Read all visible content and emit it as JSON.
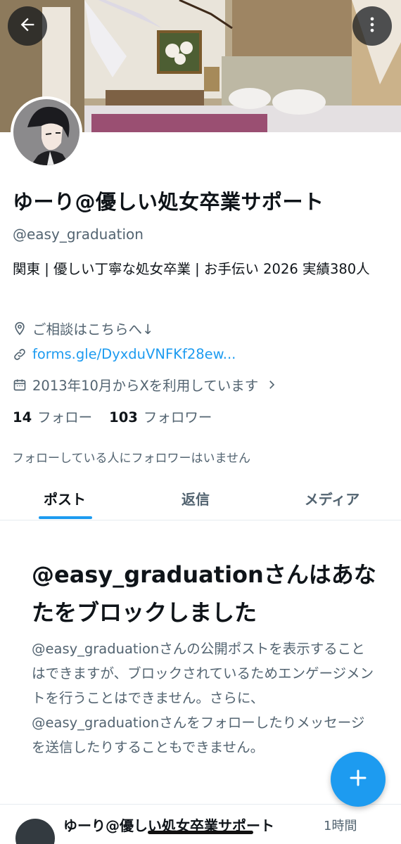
{
  "header": {
    "back_icon": "arrow-left-icon",
    "more_icon": "more-vertical-icon"
  },
  "profile": {
    "display_name": "ゆーり@優しい処女卒業サポート",
    "handle": "@easy_graduation",
    "bio": "関東 | 優しい丁寧な処女卒業 | お手伝い 2026 実績380人",
    "location": "ご相談はこちらへ↓",
    "link": "forms.gle/DyxduVNFKf28ew...",
    "joined": "2013年10月からXを利用しています",
    "following_count": "14",
    "following_label": "フォロー",
    "followers_count": "103",
    "followers_label": "フォロワー",
    "no_mutual_followers": "フォローしている人にフォロワーはいません"
  },
  "tabs": [
    {
      "label": "ポスト",
      "active": true
    },
    {
      "label": "返信",
      "active": false
    },
    {
      "label": "メディア",
      "active": false
    }
  ],
  "blocked": {
    "title": "@easy_graduationさんはあなたをブロックしました",
    "body": "@easy_graduationさんの公開ポストを表示することはできますが、ブロックされているためエンゲージメントを行うことはできません。さらに、@easy_graduationさんをフォローしたりメッセージを送信したりすることもできません。"
  },
  "next_post": {
    "name": "ゆーり@優しい処女卒業サポート",
    "time": "1時間"
  },
  "colors": {
    "accent": "#1d9bf0",
    "text_primary": "#0f1419",
    "text_secondary": "#536471"
  }
}
